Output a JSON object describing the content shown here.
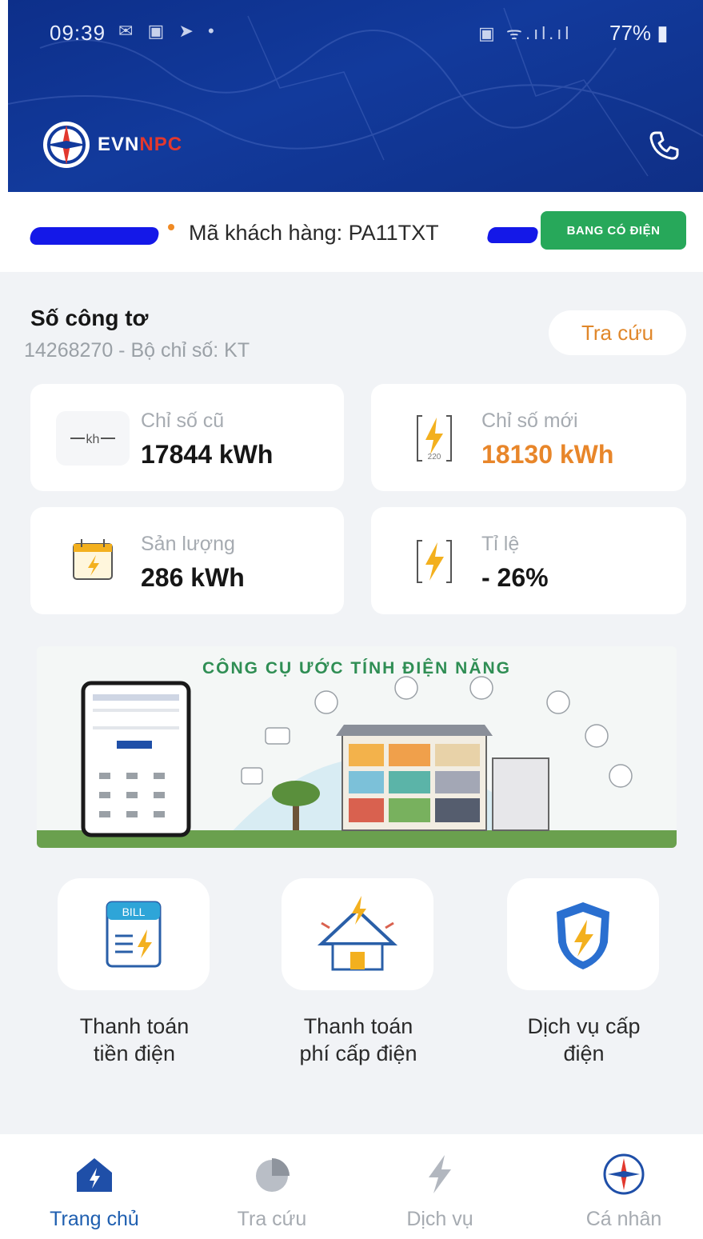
{
  "status_bar": {
    "time": "09:39",
    "left_icons": "✉ ▣ ➤ •",
    "right_icons": "▣ ᯤ.ıl.ıl",
    "battery": "77%"
  },
  "header": {
    "logo_text_main": "EVN",
    "logo_text_accent": "NPC"
  },
  "customer": {
    "label": "Mã khách hàng: PA11TXT",
    "button": "BANG CÓ ĐIỆN"
  },
  "meter": {
    "title": "Số công tơ",
    "subtitle": "14268270 - Bộ chỉ số: KT",
    "lookup_button": "Tra cứu",
    "cards": [
      {
        "label": "Chỉ số cũ",
        "value": "17844 kWh"
      },
      {
        "label": "Chỉ số mới",
        "value": "18130 kWh"
      },
      {
        "label": "Sản lượng",
        "value": "286 kWh"
      },
      {
        "label": "Tỉ lệ",
        "value": "- 26%"
      }
    ]
  },
  "banner": {
    "title": "CÔNG CỤ ƯỚC TÍNH ĐIỆN NĂNG"
  },
  "services": [
    {
      "label_line1": "Thanh toán",
      "label_line2": "tiền điện",
      "icon": "bill-icon"
    },
    {
      "label_line1": "Thanh toán",
      "label_line2": "phí cấp điện",
      "icon": "house-power-icon"
    },
    {
      "label_line1": "Dịch vụ cấp",
      "label_line2": "điện",
      "icon": "shield-bolt-icon"
    }
  ],
  "bottom_nav": [
    {
      "label": "Trang chủ",
      "icon": "home-icon",
      "active": true
    },
    {
      "label": "Tra cứu",
      "icon": "pie-chart-icon",
      "active": false
    },
    {
      "label": "Dịch vụ",
      "icon": "bolt-icon",
      "active": false
    },
    {
      "label": "Cá nhân",
      "icon": "evn-logo-icon",
      "active": false
    }
  ],
  "colors": {
    "header_blue": "#123a9c",
    "accent_orange": "#e8862a",
    "green_button": "#27a85a",
    "nav_active": "#1f5fb0",
    "redaction": "#1418e8"
  }
}
